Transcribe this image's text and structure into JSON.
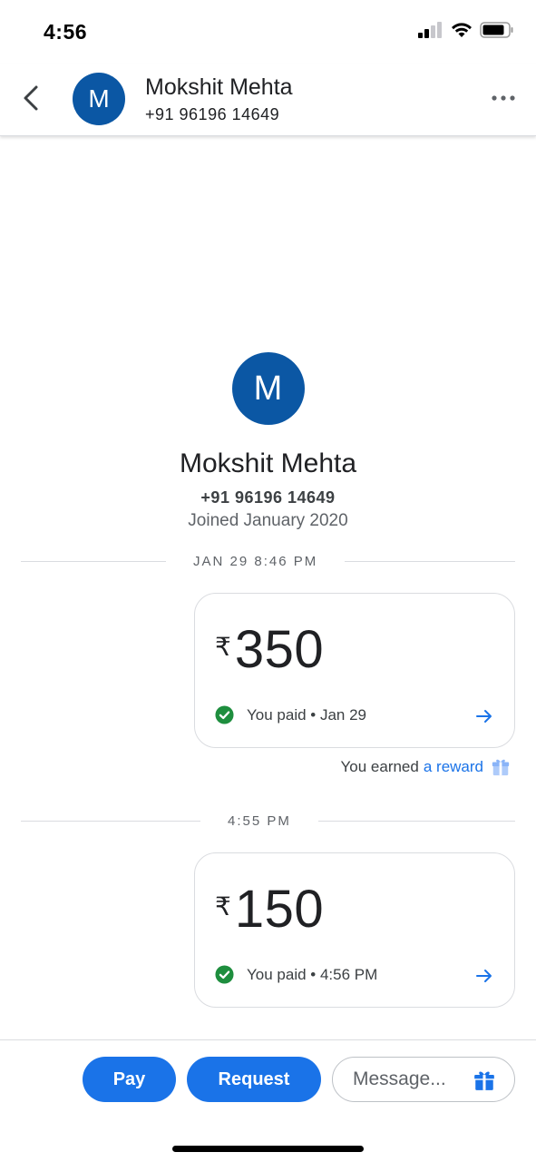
{
  "status_bar": {
    "time": "4:56"
  },
  "header": {
    "avatar_letter": "M",
    "name": "Mokshit Mehta",
    "phone": "+91 96196 14649"
  },
  "profile": {
    "avatar_letter": "M",
    "name": "Mokshit Mehta",
    "phone": "+91 96196 14649",
    "joined": "Joined January 2020"
  },
  "timeline": [
    {
      "divider": "JAN 29 8:46 PM",
      "currency": "₹",
      "amount": "350",
      "status": "You paid • Jan 29"
    },
    {
      "divider": "4:55 PM",
      "currency": "₹",
      "amount": "150",
      "status": "You paid • 4:56 PM"
    }
  ],
  "reward": {
    "prefix": "You earned",
    "link": "a reward"
  },
  "bottom_bar": {
    "pay_label": "Pay",
    "request_label": "Request",
    "message_placeholder": "Message..."
  },
  "colors": {
    "accent": "#1a73e8",
    "avatar": "#0b57a4",
    "success": "#1e8e3e"
  },
  "icons": [
    "back-arrow-icon",
    "more-options-icon",
    "check-circle-icon",
    "arrow-right-icon",
    "gift-icon",
    "signal-icon",
    "wifi-icon",
    "battery-icon"
  ]
}
